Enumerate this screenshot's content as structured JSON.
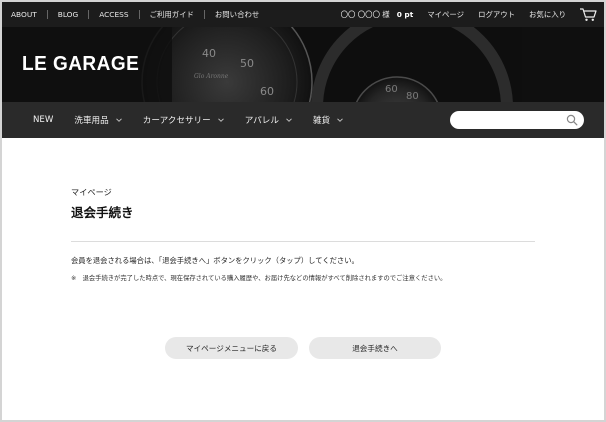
{
  "topbar": {
    "links": [
      "ABOUT",
      "BLOG",
      "ACCESS",
      "ご利用ガイド",
      "お問い合わせ"
    ],
    "user_name": "〇〇 〇〇〇 様",
    "points": "0 pt",
    "mypage": "マイページ",
    "logout": "ログアウト",
    "favorites": "お気に入り"
  },
  "brand": {
    "logo": "LE GARAGE"
  },
  "nav": {
    "items": [
      {
        "label": "NEW",
        "has_dropdown": false
      },
      {
        "label": "洗車用品",
        "has_dropdown": true
      },
      {
        "label": "カーアクセサリー",
        "has_dropdown": true
      },
      {
        "label": "アパレル",
        "has_dropdown": true
      },
      {
        "label": "雑貨",
        "has_dropdown": true
      }
    ],
    "search_placeholder": ""
  },
  "main": {
    "breadcrumb": "マイページ",
    "title": "退会手続き",
    "description": "会員を退会される場合は、「退会手続きへ」ボタンをクリック（タップ）してください。",
    "note": "※　退会手続きが完了した時点で、現在保存されている購入履歴や、お届け先などの情報がすべて削除されますのでご注意ください。",
    "back_button": "マイページメニューに戻る",
    "withdraw_button": "退会手続きへ"
  },
  "colors": {
    "topbar_bg": "#1c1c1c",
    "nav_bg": "#2a2a2a",
    "button_bg": "#e8e8e8"
  },
  "icons": [
    "chevron-down-icon",
    "search-icon",
    "cart-icon"
  ]
}
